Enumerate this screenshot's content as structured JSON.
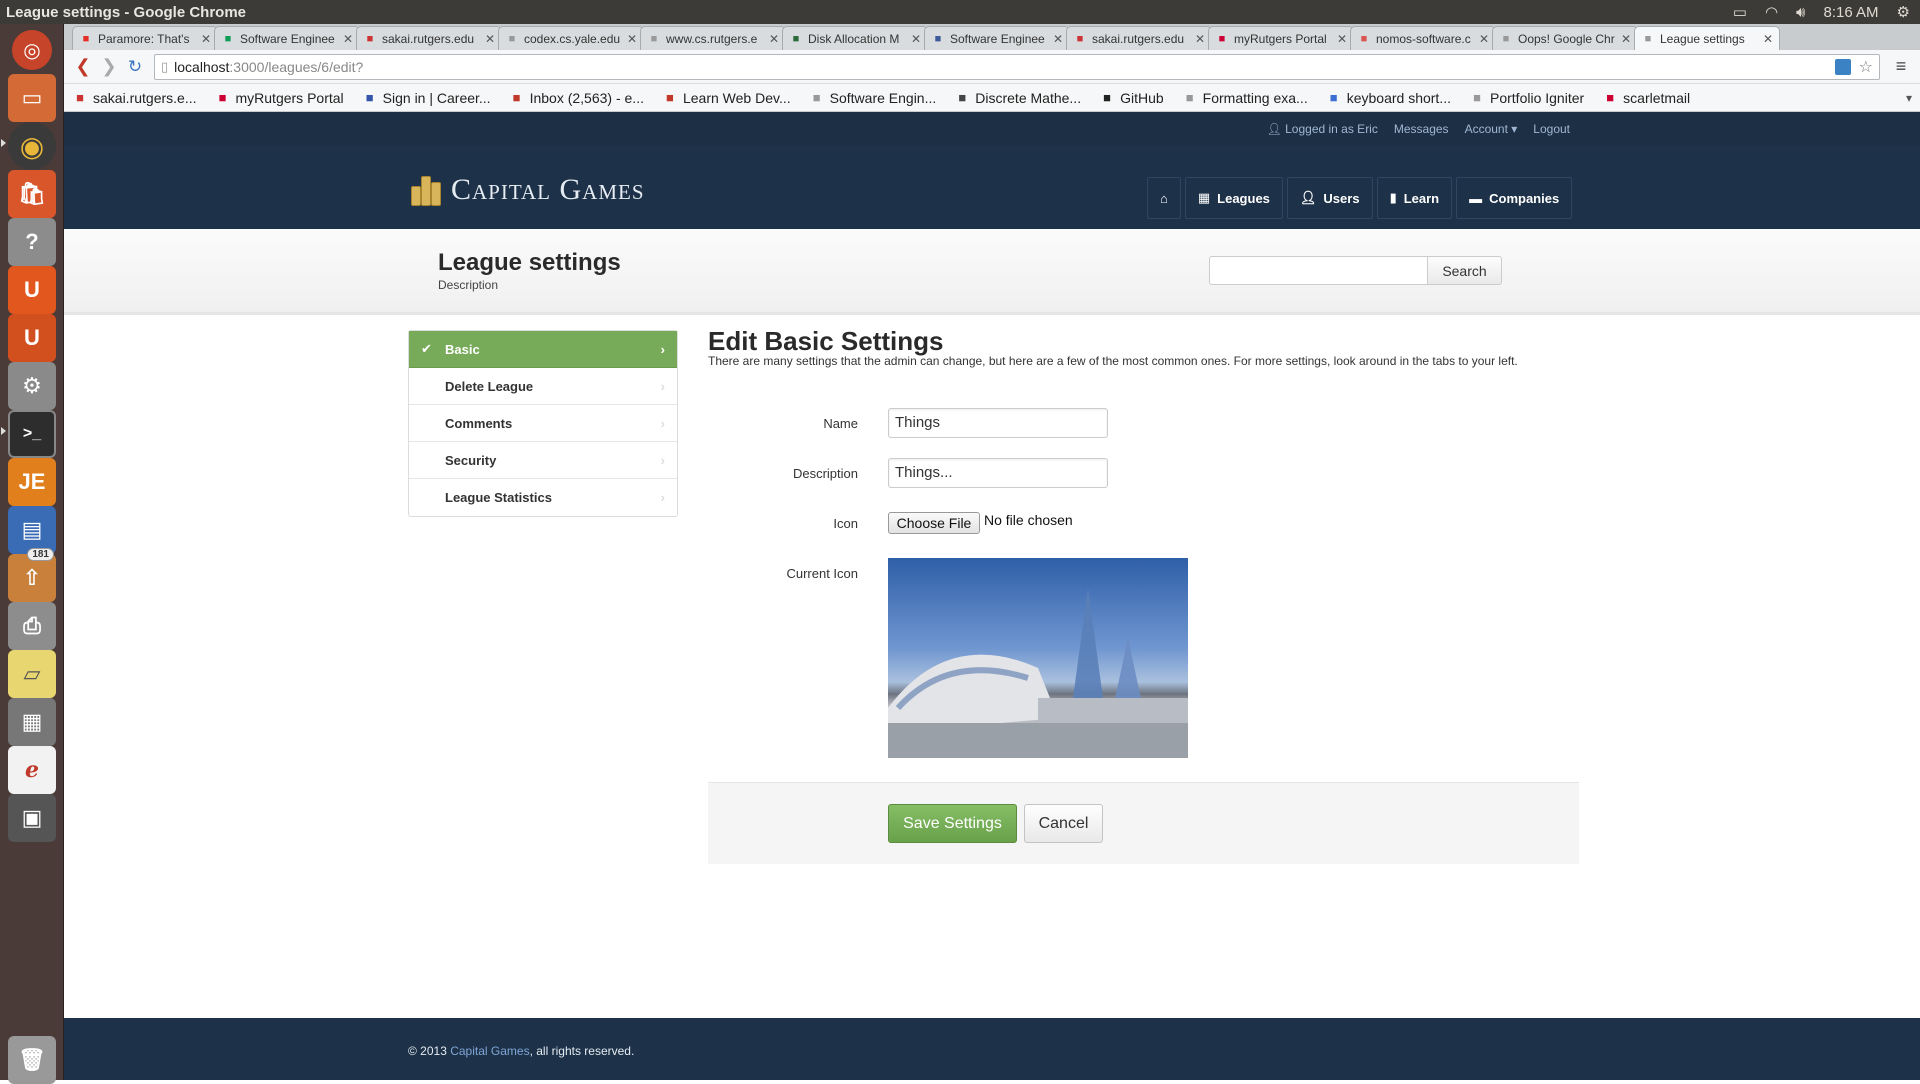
{
  "os": {
    "window_title": "League settings - Google Chrome",
    "clock": "8:16 AM",
    "launcher_badge": "181"
  },
  "browser": {
    "tabs": [
      {
        "label": "Paramore: That's",
        "icon": "youtube-icon",
        "color": "#e52d27"
      },
      {
        "label": "Software Enginee",
        "icon": "sheets-icon",
        "color": "#0f9d58"
      },
      {
        "label": "sakai.rutgers.edu",
        "icon": "sakai-icon",
        "color": "#cc3333"
      },
      {
        "label": "codex.cs.yale.edu",
        "icon": "page-icon",
        "color": "#999999"
      },
      {
        "label": "www.cs.rutgers.e",
        "icon": "page-icon",
        "color": "#999999"
      },
      {
        "label": "Disk Allocation M",
        "icon": "cs-icon",
        "color": "#2a6b3c"
      },
      {
        "label": "Software Enginee",
        "icon": "facebook-icon",
        "color": "#3b5998"
      },
      {
        "label": "sakai.rutgers.edu",
        "icon": "sakai-icon",
        "color": "#cc3333"
      },
      {
        "label": "myRutgers Portal",
        "icon": "rutgers-icon",
        "color": "#cc0033"
      },
      {
        "label": "nomos-software.c",
        "icon": "nomos-icon",
        "color": "#d9534f"
      },
      {
        "label": "Oops! Google Chr",
        "icon": "page-icon",
        "color": "#999999"
      },
      {
        "label": "League settings",
        "icon": "page-icon",
        "color": "#999999",
        "active": true
      }
    ],
    "url_host": "localhost",
    "url_path": ":3000/leagues/6/edit?",
    "bookmarks": [
      {
        "label": "sakai.rutgers.e...",
        "icon": "sakai-icon",
        "color": "#cc3333"
      },
      {
        "label": "myRutgers Portal",
        "icon": "rutgers-icon",
        "color": "#cc0033"
      },
      {
        "label": "Sign in | Career...",
        "icon": "career-icon",
        "color": "#3355aa"
      },
      {
        "label": "Inbox (2,563) - e...",
        "icon": "gmail-icon",
        "color": "#c0392b"
      },
      {
        "label": "Learn Web Dev...",
        "icon": "bolt-icon",
        "color": "#c0392b"
      },
      {
        "label": "Software Engin...",
        "icon": "page-icon",
        "color": "#999999"
      },
      {
        "label": "Discrete Mathe...",
        "icon": "shield-icon",
        "color": "#444444"
      },
      {
        "label": "GitHub",
        "icon": "github-icon",
        "color": "#222222"
      },
      {
        "label": "Formatting exa...",
        "icon": "page-icon",
        "color": "#999999"
      },
      {
        "label": "keyboard short...",
        "icon": "docs-icon",
        "color": "#3b6fd4"
      },
      {
        "label": "Portfolio Igniter",
        "icon": "page-icon",
        "color": "#999999"
      },
      {
        "label": "scarletmail",
        "icon": "rutgers-icon",
        "color": "#cc0033"
      }
    ]
  },
  "userbar": {
    "logged_in": "Logged in as Eric",
    "messages": "Messages",
    "account": "Account",
    "logout": "Logout"
  },
  "brand": {
    "name": "Capital Games",
    "gold": "#d8b45a"
  },
  "nav": {
    "leagues": "Leagues",
    "users": "Users",
    "learn": "Learn",
    "companies": "Companies"
  },
  "page": {
    "title": "League settings",
    "subtitle": "Description",
    "search_button": "Search"
  },
  "sidemenu": [
    {
      "label": "Basic",
      "active": true
    },
    {
      "label": "Delete League"
    },
    {
      "label": "Comments"
    },
    {
      "label": "Security"
    },
    {
      "label": "League Statistics"
    }
  ],
  "form": {
    "title": "Edit Basic Settings",
    "description": "There are many settings that the admin can change, but here are a few of the most common ones. For more settings, look around in the tabs to your left.",
    "name_label": "Name",
    "name_value": "Things",
    "description_label": "Description",
    "description_value": "Things...",
    "icon_label": "Icon",
    "choose_file": "Choose File",
    "no_file": "No file chosen",
    "current_icon_label": "Current Icon",
    "save": "Save Settings",
    "cancel": "Cancel"
  },
  "footer": {
    "prefix": "© 2013 ",
    "link": "Capital Games",
    "suffix": ", all rights reserved."
  },
  "colors": {
    "accent_green": "#77ab59",
    "header_navy": "#1d3149",
    "link_blue": "#7fa6d6"
  }
}
